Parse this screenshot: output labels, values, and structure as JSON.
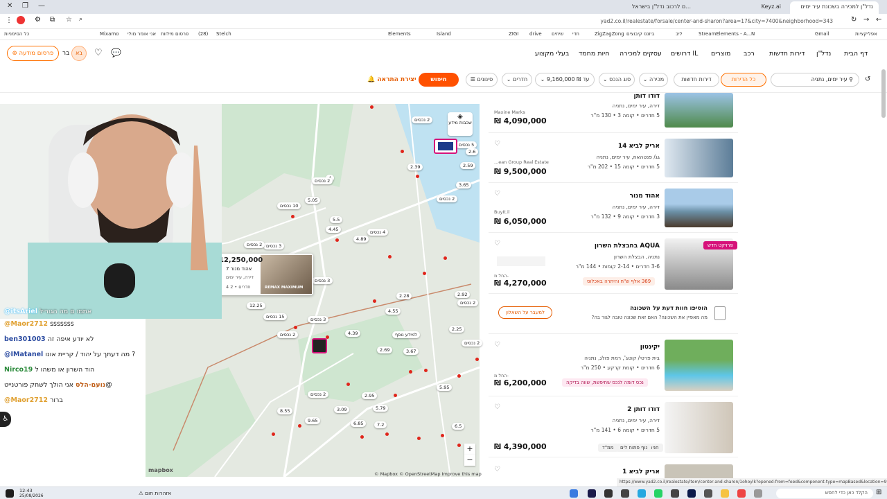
{
  "browser": {
    "tabs": [
      {
        "label": "נדל\"ן למכירה בשכונת עיר ימים",
        "active": true
      },
      {
        "label": "Keyz.ai",
        "active": false
      },
      {
        "label": "...ם לרכוב נדל\"ן בישראל",
        "active": false
      }
    ],
    "url": "yad2.co.il/realestate/forsale/center-and-sharon?area=17&city=7400&neighborhood=343",
    "bookmarks": [
      "כל הסימניות",
      "אפליקציות",
      "Gmail",
      "N",
      "StreamElements - A...",
      "ליב",
      "ביזנס קיבוצים",
      "ZigZagZong",
      "חדי",
      "שיחים",
      "drive",
      "ZIGI",
      "G",
      "G",
      "Island",
      "Elements",
      "R",
      "H",
      "W",
      "Z",
      "D",
      "Up",
      "Stelch",
      "(28)",
      "פרסום מילוות",
      "אני אומר מולי",
      "Mixamo",
      "K"
    ]
  },
  "site": {
    "nav": [
      "דף הבית",
      "נדל\"ן",
      "דירות חדשות",
      "רכב",
      "מוצרים",
      "דרושים IL",
      "עסקים למכירה",
      "חיות מחמד",
      "בעלי מקצוע"
    ],
    "post_button": "פרסום מודעה",
    "avatar_initials": "בא",
    "user_label": "בר"
  },
  "filters": {
    "location": "עיר ימים, נתניה",
    "all_properties": "כל הדירות",
    "new_properties": "דירות חדשות",
    "sale": "מכירה",
    "property_type": "סוג הנכס",
    "price": "עד ₪ 9,160,000",
    "rooms": "חדרים",
    "filters": "סינונים",
    "search": "חיפוש",
    "create_alert": "יצירת התראה"
  },
  "map": {
    "layers_label": "שכבות מידע",
    "zoom_in": "+",
    "zoom_out": "−",
    "attribution": "© Mapbox © OpenStreetMap  Improve this map",
    "logo": "mapbox",
    "popup": {
      "price": "12,250,000",
      "title": "אהוד מנור 7",
      "sub": "דירה, עיר ימים",
      "rooms": "4 חדרים • 2",
      "agency": "REMAX MAXIMUM"
    },
    "pins": [
      "2 נכסים",
      "5 נכסים",
      "2.6",
      "2.39",
      "2.59",
      "3.65",
      "2 נכסים",
      "4",
      "5.05",
      "2 נכסים",
      "10 נכסים",
      "5.5",
      "4.45",
      "4 נכסים",
      "4.89",
      "3 נכסים",
      "2 נכסים",
      "3 נכסים",
      "2.28",
      "4.55",
      "2.92",
      "2 נכסים",
      "12.25",
      "15 נכסים",
      "3 נכסים",
      "2 נכסים",
      "4.39",
      "למידע נוסף",
      "2.25",
      "2 נכסים",
      "2.69",
      "3.67",
      "5.95",
      "2 נכסים",
      "2.95",
      "3.09",
      "5.79",
      "8.55",
      "9.65",
      "6.85",
      "7.2",
      "6.5"
    ]
  },
  "listings": [
    {
      "title": "דודו דותן",
      "sub1": "דירה, עיר ימים, נתניה",
      "sub2": "5 חדרים • קומה 3 • 130 מ\"ר",
      "price": "₪ 4,090,000",
      "agency": "Maxine Marks"
    },
    {
      "title": "אריק לביא 14",
      "sub1": "גג/ פנטהאוז, עיר ימים, נתניה",
      "sub2": "5 חדרים • קומה 15 • 202 מ\"ר",
      "price": "₪ 9,500,000",
      "agency": "...ean Group Real Estate"
    },
    {
      "title": "אהוד מנור",
      "sub1": "דירה, עיר ימים, נתניה",
      "sub2": "3 חדרים • קומה 9 • 132 מ\"ר",
      "price": "₪ 6,050,000",
      "agency": "BuyIt.il"
    },
    {
      "title": "AQUA בחבצלת השרון",
      "sub1": "נתניה, הבצלת השרון",
      "sub2": "3-6 חדרים • 2-14 קומות • 144 מ\"ר",
      "price": "₪ 4,270,000",
      "price_prefix": "החל מ-",
      "badge": "פרויקט חדש",
      "promo": "369 אלף ש\"ח והיתרה באכלוס"
    },
    {
      "title": "יקינטון",
      "sub1": "בית פרטי/ קוטג', רמת פולג, נתניה",
      "sub2": "6 חדרים • קומת קרקע • 250 מ\"ר",
      "price": "₪ 6,200,000",
      "price_prefix": "החל מ-",
      "promo": "נכס דומה לנכס שחיפשת, שווה בדיקה"
    },
    {
      "title": "דודו דותן 2",
      "sub1": "דירה, עיר ימים, נתניה",
      "sub2": "5 חדרים • קומה 6 • 141 מ\"ר",
      "price": "₪ 4,390,000",
      "tags": [
        "חניה",
        "נוף פתוח לים",
        "ממ\"ד"
      ]
    },
    {
      "title": "אריק לביא 1"
    }
  ],
  "survey": {
    "title": "הוסיפו חוות דעת על השכונה",
    "text": "מה מאפיין את השכונה? האם זאת שכונה טובה לגור בה?",
    "button": "למעבר על השאלון"
  },
  "stream_chat": [
    {
      "user": "@itsAriel",
      "text": "אתמו ם מה הגוריל"
    },
    {
      "user": "@Maor2712",
      "text": "sssssss"
    },
    {
      "user": "ben301003",
      "text": "לא יודע איפה זה"
    },
    {
      "user": "@IMatanel",
      "text": "מה דעתך על יהוד / קריית אונו ?"
    },
    {
      "user": "Nirco19",
      "text": "הוד השרון או משהו ל"
    },
    {
      "user": "נועם-הלס",
      "text": "אני הולך לשחק פורטנייט@"
    },
    {
      "user": "@Maor2712",
      "text": "ברור"
    }
  ],
  "status_url": "https://www.yad2.co.il/realestate/item/center-and-sharon/1ohoylk?opened-from=feed&component-type=mapBased&location=999",
  "taskbar": {
    "time": "12:43",
    "date": "25/08/2026",
    "weather": "אזהרות חום",
    "search": "הקלד כאן כדי לחפש"
  },
  "colors": {
    "accent": "#ff5100",
    "brand_orange": "#ff7100",
    "pin_red": "#e0251b",
    "new_project_pink": "#d6127a"
  }
}
